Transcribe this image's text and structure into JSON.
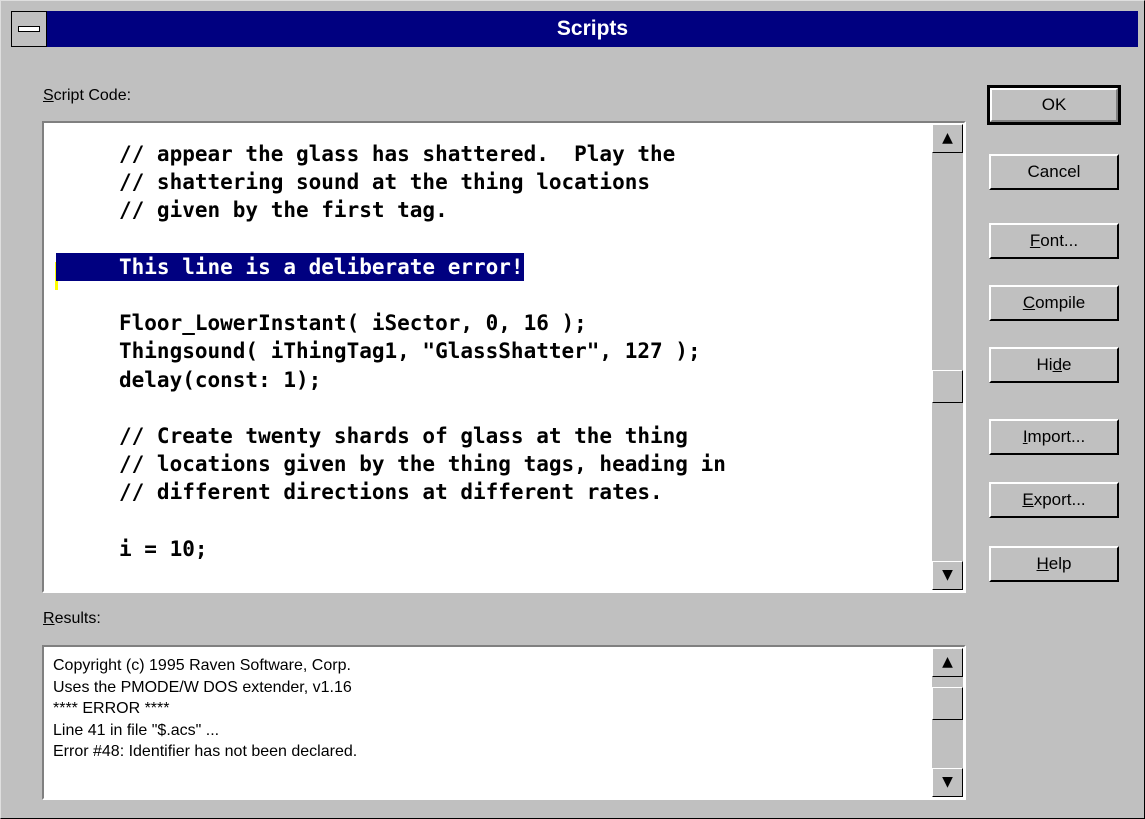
{
  "window": {
    "title": "Scripts"
  },
  "labels": {
    "script_code_first": "S",
    "script_code_rest": "cript Code:",
    "results_first": "R",
    "results_rest": "esults:"
  },
  "code_lines": [
    "// appear the glass has shattered.  Play the",
    "// shattering sound at the thing locations",
    "// given by the first tag.",
    "",
    "This line is a deliberate error!",
    "",
    "Floor_LowerInstant( iSector, 0, 16 );",
    "Thingsound( iThingTag1, \"GlassShatter\", 127 );",
    "delay(const: 1);",
    "",
    "// Create twenty shards of glass at the thing",
    "// locations given by the thing tags, heading in",
    "// different directions at different rates.",
    "",
    "i = 10;"
  ],
  "selected_line_index": 4,
  "results_lines": [
    "Copyright (c) 1995 Raven Software, Corp.",
    "Uses the PMODE/W DOS extender, v1.16",
    "**** ERROR ****",
    "Line 41 in file \"$.acs\" ...",
    "Error #48: Identifier has not been declared."
  ],
  "buttons": {
    "ok": {
      "pre": "",
      "key": "",
      "post": "OK"
    },
    "cancel": {
      "pre": "",
      "key": "",
      "post": "Cancel"
    },
    "font": {
      "pre": "",
      "key": "F",
      "post": "ont..."
    },
    "compile": {
      "pre": "",
      "key": "C",
      "post": "ompile"
    },
    "hide": {
      "pre": "Hi",
      "key": "d",
      "post": "e"
    },
    "import": {
      "pre": "",
      "key": "I",
      "post": "mport..."
    },
    "export": {
      "pre": "",
      "key": "E",
      "post": "xport..."
    },
    "help": {
      "pre": "",
      "key": "H",
      "post": "elp"
    }
  },
  "icons": {
    "scroll_up": "up-arrow-icon",
    "scroll_down": "down-arrow-icon",
    "system_menu": "system-menu-icon"
  },
  "colors": {
    "titlebar": "#000080",
    "face": "#c0c0c0",
    "selection": "#000080",
    "caret": "#ffff00"
  }
}
